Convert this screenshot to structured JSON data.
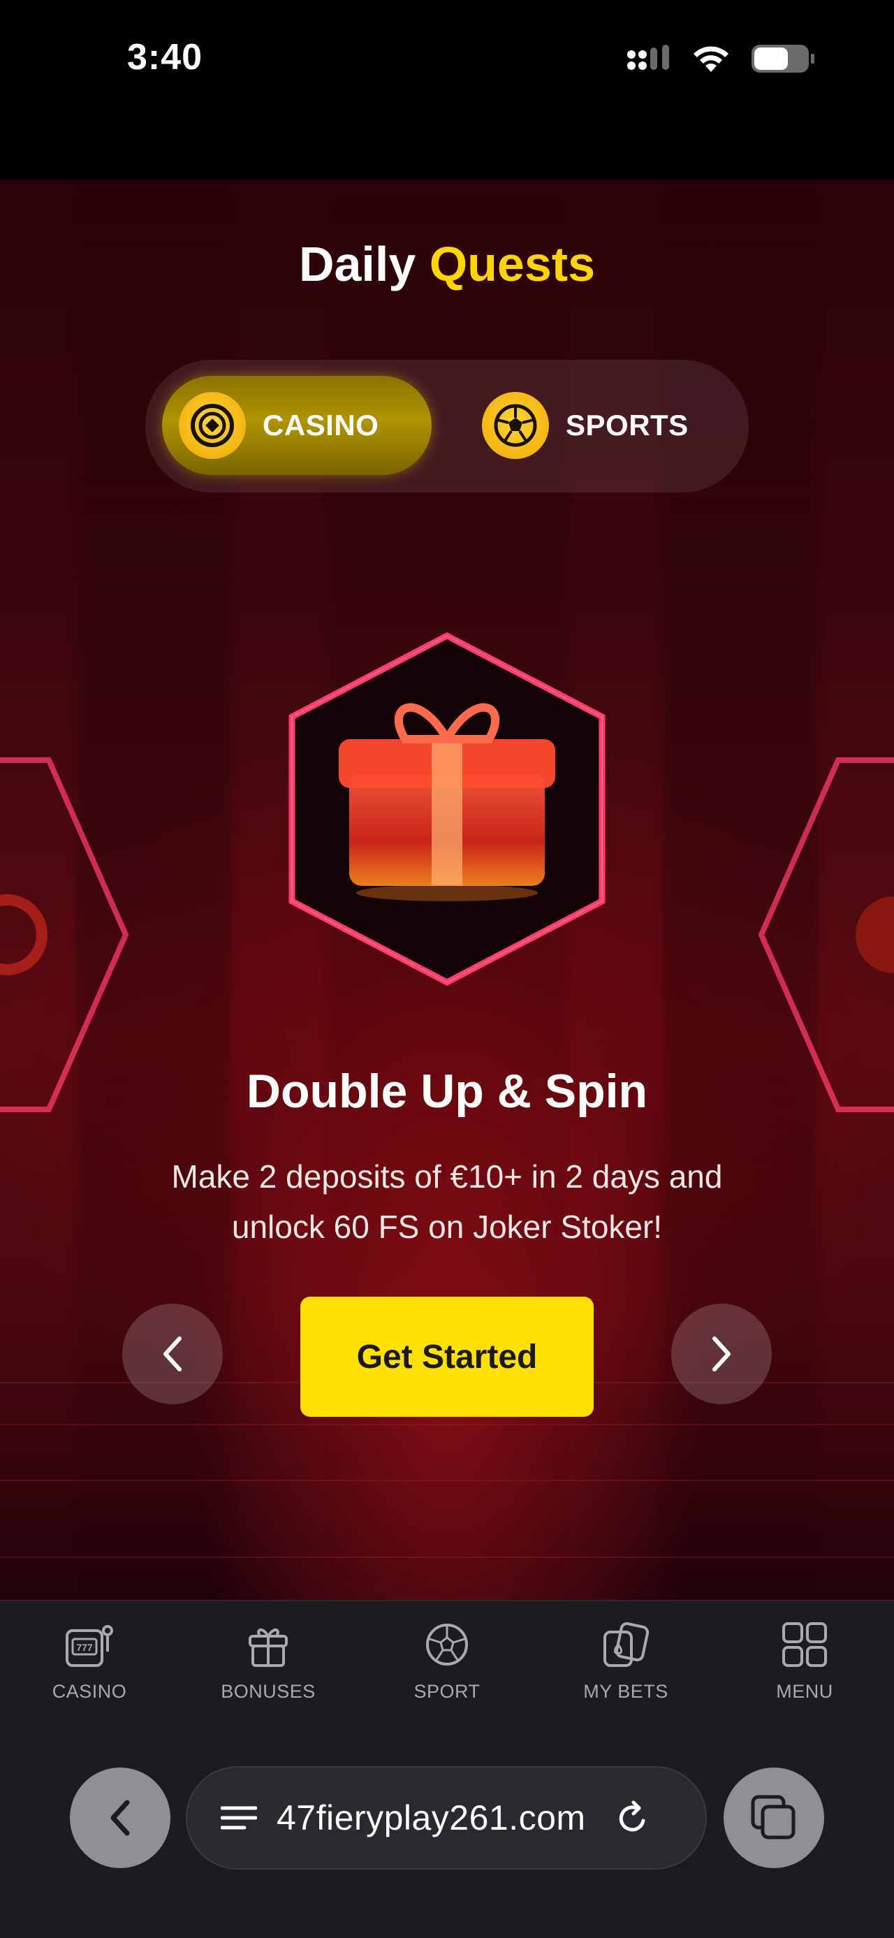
{
  "status_bar": {
    "time": "3:40"
  },
  "header": {
    "title_part1": "Daily",
    "title_part2": "Quests"
  },
  "tabs": [
    {
      "label": "CASINO",
      "icon": "casino-chip-icon",
      "active": true
    },
    {
      "label": "SPORTS",
      "icon": "soccer-ball-icon",
      "active": false
    }
  ],
  "quest": {
    "title": "Double Up & Spin",
    "description_line1": "Make 2 deposits of €10+ in 2 days and",
    "description_line2": "unlock 60 FS on Joker Stoker!",
    "cta_label": "Get Started",
    "icon": "gift-box-icon"
  },
  "bottom_nav": [
    {
      "label": "CASINO",
      "icon": "slot-machine-icon"
    },
    {
      "label": "BONUSES",
      "icon": "gift-icon"
    },
    {
      "label": "SPORT",
      "icon": "soccer-ball-icon"
    },
    {
      "label": "MY BETS",
      "icon": "cards-icon"
    },
    {
      "label": "MENU",
      "icon": "grid-icon"
    }
  ],
  "browser": {
    "url": "47fieryplay261.com"
  },
  "colors": {
    "accent_yellow": "#ffd400",
    "cta_yellow": "#ffe000",
    "hex_outline": "#ff3b6b"
  }
}
